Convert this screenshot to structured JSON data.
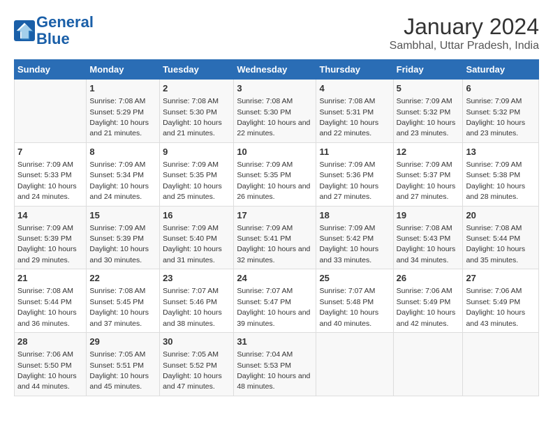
{
  "logo": {
    "line1": "General",
    "line2": "Blue"
  },
  "title": "January 2024",
  "subtitle": "Sambhal, Uttar Pradesh, India",
  "headers": [
    "Sunday",
    "Monday",
    "Tuesday",
    "Wednesday",
    "Thursday",
    "Friday",
    "Saturday"
  ],
  "weeks": [
    [
      {
        "day": "",
        "sunrise": "",
        "sunset": "",
        "daylight": ""
      },
      {
        "day": "1",
        "sunrise": "Sunrise: 7:08 AM",
        "sunset": "Sunset: 5:29 PM",
        "daylight": "Daylight: 10 hours and 21 minutes."
      },
      {
        "day": "2",
        "sunrise": "Sunrise: 7:08 AM",
        "sunset": "Sunset: 5:30 PM",
        "daylight": "Daylight: 10 hours and 21 minutes."
      },
      {
        "day": "3",
        "sunrise": "Sunrise: 7:08 AM",
        "sunset": "Sunset: 5:30 PM",
        "daylight": "Daylight: 10 hours and 22 minutes."
      },
      {
        "day": "4",
        "sunrise": "Sunrise: 7:08 AM",
        "sunset": "Sunset: 5:31 PM",
        "daylight": "Daylight: 10 hours and 22 minutes."
      },
      {
        "day": "5",
        "sunrise": "Sunrise: 7:09 AM",
        "sunset": "Sunset: 5:32 PM",
        "daylight": "Daylight: 10 hours and 23 minutes."
      },
      {
        "day": "6",
        "sunrise": "Sunrise: 7:09 AM",
        "sunset": "Sunset: 5:32 PM",
        "daylight": "Daylight: 10 hours and 23 minutes."
      }
    ],
    [
      {
        "day": "7",
        "sunrise": "Sunrise: 7:09 AM",
        "sunset": "Sunset: 5:33 PM",
        "daylight": "Daylight: 10 hours and 24 minutes."
      },
      {
        "day": "8",
        "sunrise": "Sunrise: 7:09 AM",
        "sunset": "Sunset: 5:34 PM",
        "daylight": "Daylight: 10 hours and 24 minutes."
      },
      {
        "day": "9",
        "sunrise": "Sunrise: 7:09 AM",
        "sunset": "Sunset: 5:35 PM",
        "daylight": "Daylight: 10 hours and 25 minutes."
      },
      {
        "day": "10",
        "sunrise": "Sunrise: 7:09 AM",
        "sunset": "Sunset: 5:35 PM",
        "daylight": "Daylight: 10 hours and 26 minutes."
      },
      {
        "day": "11",
        "sunrise": "Sunrise: 7:09 AM",
        "sunset": "Sunset: 5:36 PM",
        "daylight": "Daylight: 10 hours and 27 minutes."
      },
      {
        "day": "12",
        "sunrise": "Sunrise: 7:09 AM",
        "sunset": "Sunset: 5:37 PM",
        "daylight": "Daylight: 10 hours and 27 minutes."
      },
      {
        "day": "13",
        "sunrise": "Sunrise: 7:09 AM",
        "sunset": "Sunset: 5:38 PM",
        "daylight": "Daylight: 10 hours and 28 minutes."
      }
    ],
    [
      {
        "day": "14",
        "sunrise": "Sunrise: 7:09 AM",
        "sunset": "Sunset: 5:39 PM",
        "daylight": "Daylight: 10 hours and 29 minutes."
      },
      {
        "day": "15",
        "sunrise": "Sunrise: 7:09 AM",
        "sunset": "Sunset: 5:39 PM",
        "daylight": "Daylight: 10 hours and 30 minutes."
      },
      {
        "day": "16",
        "sunrise": "Sunrise: 7:09 AM",
        "sunset": "Sunset: 5:40 PM",
        "daylight": "Daylight: 10 hours and 31 minutes."
      },
      {
        "day": "17",
        "sunrise": "Sunrise: 7:09 AM",
        "sunset": "Sunset: 5:41 PM",
        "daylight": "Daylight: 10 hours and 32 minutes."
      },
      {
        "day": "18",
        "sunrise": "Sunrise: 7:09 AM",
        "sunset": "Sunset: 5:42 PM",
        "daylight": "Daylight: 10 hours and 33 minutes."
      },
      {
        "day": "19",
        "sunrise": "Sunrise: 7:08 AM",
        "sunset": "Sunset: 5:43 PM",
        "daylight": "Daylight: 10 hours and 34 minutes."
      },
      {
        "day": "20",
        "sunrise": "Sunrise: 7:08 AM",
        "sunset": "Sunset: 5:44 PM",
        "daylight": "Daylight: 10 hours and 35 minutes."
      }
    ],
    [
      {
        "day": "21",
        "sunrise": "Sunrise: 7:08 AM",
        "sunset": "Sunset: 5:44 PM",
        "daylight": "Daylight: 10 hours and 36 minutes."
      },
      {
        "day": "22",
        "sunrise": "Sunrise: 7:08 AM",
        "sunset": "Sunset: 5:45 PM",
        "daylight": "Daylight: 10 hours and 37 minutes."
      },
      {
        "day": "23",
        "sunrise": "Sunrise: 7:07 AM",
        "sunset": "Sunset: 5:46 PM",
        "daylight": "Daylight: 10 hours and 38 minutes."
      },
      {
        "day": "24",
        "sunrise": "Sunrise: 7:07 AM",
        "sunset": "Sunset: 5:47 PM",
        "daylight": "Daylight: 10 hours and 39 minutes."
      },
      {
        "day": "25",
        "sunrise": "Sunrise: 7:07 AM",
        "sunset": "Sunset: 5:48 PM",
        "daylight": "Daylight: 10 hours and 40 minutes."
      },
      {
        "day": "26",
        "sunrise": "Sunrise: 7:06 AM",
        "sunset": "Sunset: 5:49 PM",
        "daylight": "Daylight: 10 hours and 42 minutes."
      },
      {
        "day": "27",
        "sunrise": "Sunrise: 7:06 AM",
        "sunset": "Sunset: 5:49 PM",
        "daylight": "Daylight: 10 hours and 43 minutes."
      }
    ],
    [
      {
        "day": "28",
        "sunrise": "Sunrise: 7:06 AM",
        "sunset": "Sunset: 5:50 PM",
        "daylight": "Daylight: 10 hours and 44 minutes."
      },
      {
        "day": "29",
        "sunrise": "Sunrise: 7:05 AM",
        "sunset": "Sunset: 5:51 PM",
        "daylight": "Daylight: 10 hours and 45 minutes."
      },
      {
        "day": "30",
        "sunrise": "Sunrise: 7:05 AM",
        "sunset": "Sunset: 5:52 PM",
        "daylight": "Daylight: 10 hours and 47 minutes."
      },
      {
        "day": "31",
        "sunrise": "Sunrise: 7:04 AM",
        "sunset": "Sunset: 5:53 PM",
        "daylight": "Daylight: 10 hours and 48 minutes."
      },
      {
        "day": "",
        "sunrise": "",
        "sunset": "",
        "daylight": ""
      },
      {
        "day": "",
        "sunrise": "",
        "sunset": "",
        "daylight": ""
      },
      {
        "day": "",
        "sunrise": "",
        "sunset": "",
        "daylight": ""
      }
    ]
  ]
}
